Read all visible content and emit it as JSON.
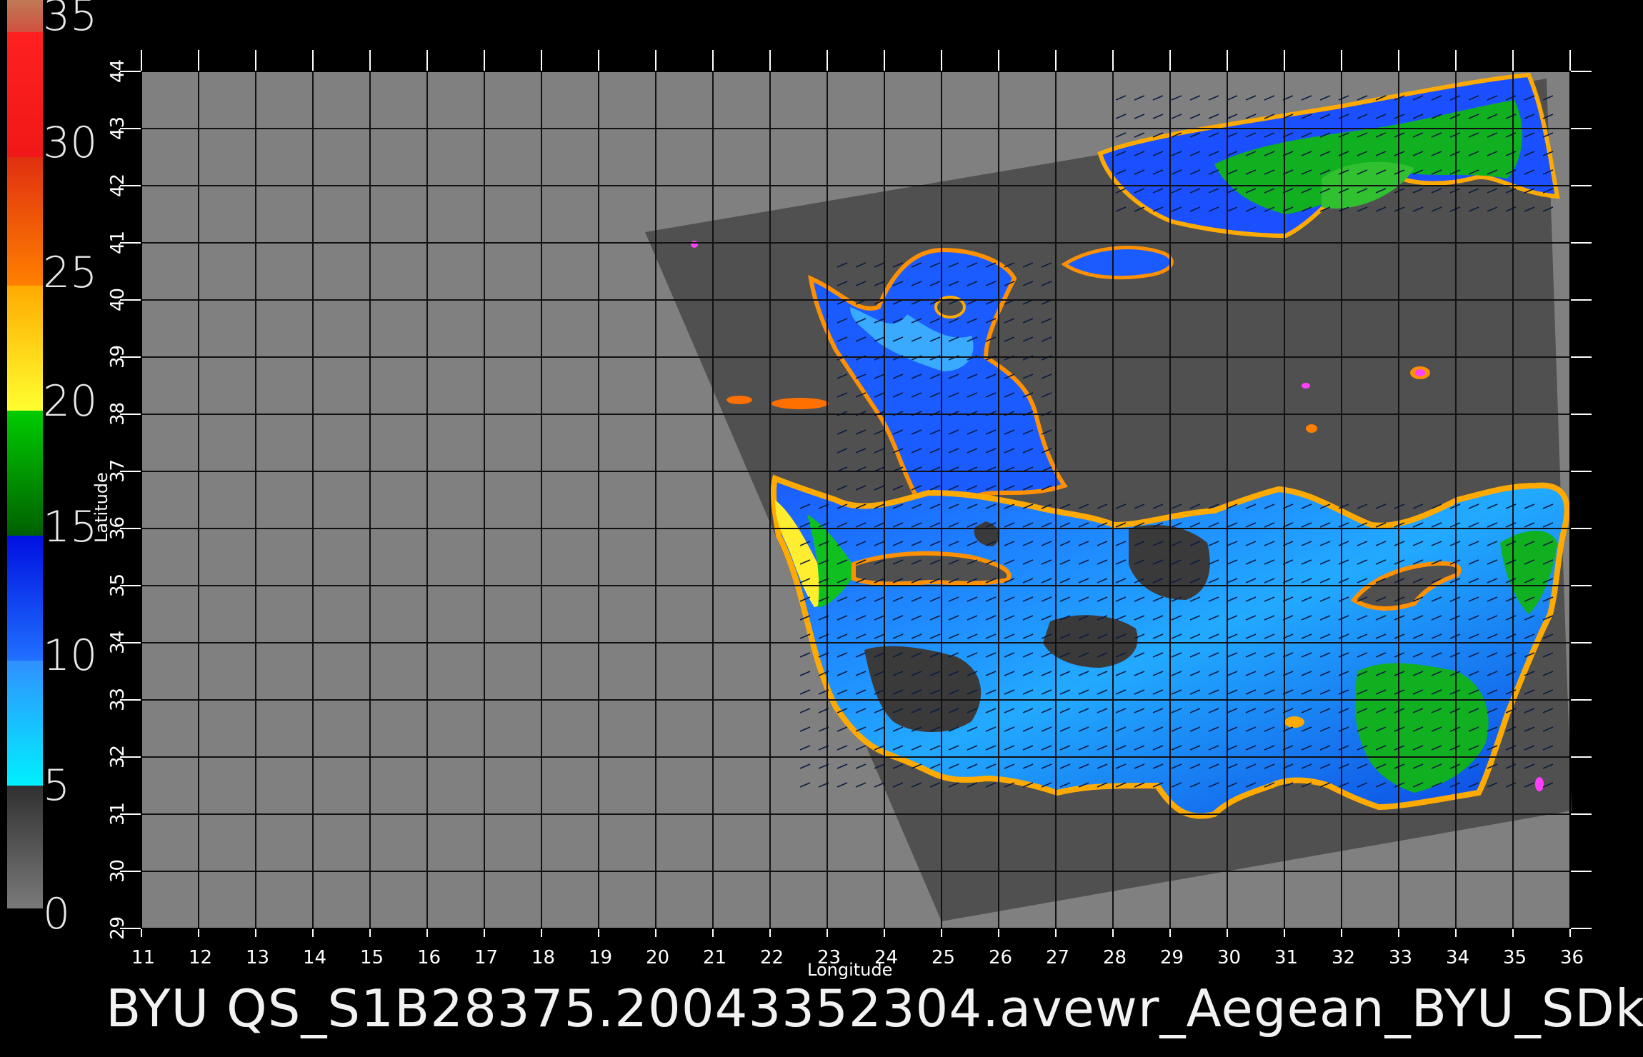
{
  "caption": "BYU  QS_S1B28375.20043352304.avewr_Aegean_BYU_SDk",
  "axes": {
    "xlabel": "Longitude",
    "ylabel": "Latitude",
    "lon_ticks": [
      "11",
      "12",
      "13",
      "14",
      "15",
      "16",
      "17",
      "18",
      "19",
      "20",
      "21",
      "22",
      "23",
      "24",
      "25",
      "26",
      "27",
      "28",
      "29",
      "30",
      "31",
      "32",
      "33",
      "34",
      "35",
      "36"
    ],
    "lat_ticks": [
      "29",
      "30",
      "31",
      "32",
      "33",
      "34",
      "35",
      "36",
      "37",
      "38",
      "39",
      "40",
      "41",
      "42",
      "43",
      "44"
    ]
  },
  "colorbar": {
    "labels": [
      "35",
      "30",
      "25",
      "20",
      "15",
      "10",
      "5",
      "0"
    ]
  },
  "colors": {
    "background": "#000000",
    "no_data_gray": "#808080",
    "swath_gray": "#505050",
    "land_dark": "#3a3a3a",
    "grid": "#111111"
  }
}
